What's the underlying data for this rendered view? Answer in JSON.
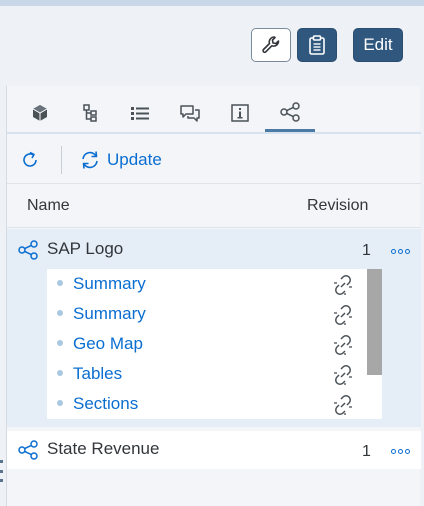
{
  "header": {
    "wrench_icon": "wrench-icon",
    "clipboard_icon": "clipboard-icon",
    "edit_label": "Edit"
  },
  "tabs": [
    {
      "icon": "cube-icon"
    },
    {
      "icon": "hierarchy-icon"
    },
    {
      "icon": "list-icon"
    },
    {
      "icon": "comments-icon"
    },
    {
      "icon": "info-icon"
    },
    {
      "icon": "share-network-icon",
      "active": true
    }
  ],
  "toolbar": {
    "update_label": "Update"
  },
  "table": {
    "col_name": "Name",
    "col_revision": "Revision",
    "rows": [
      {
        "name": "SAP Logo",
        "revision": "1",
        "expanded": true,
        "children": [
          "Summary",
          "Summary",
          "Geo Map",
          "Tables",
          "Sections"
        ]
      },
      {
        "name": "State Revenue",
        "revision": "1",
        "expanded": false
      }
    ]
  },
  "colors": {
    "accent": "#0a6ed1",
    "button_dark": "#30587e",
    "selected_row": "#e5edf7"
  }
}
